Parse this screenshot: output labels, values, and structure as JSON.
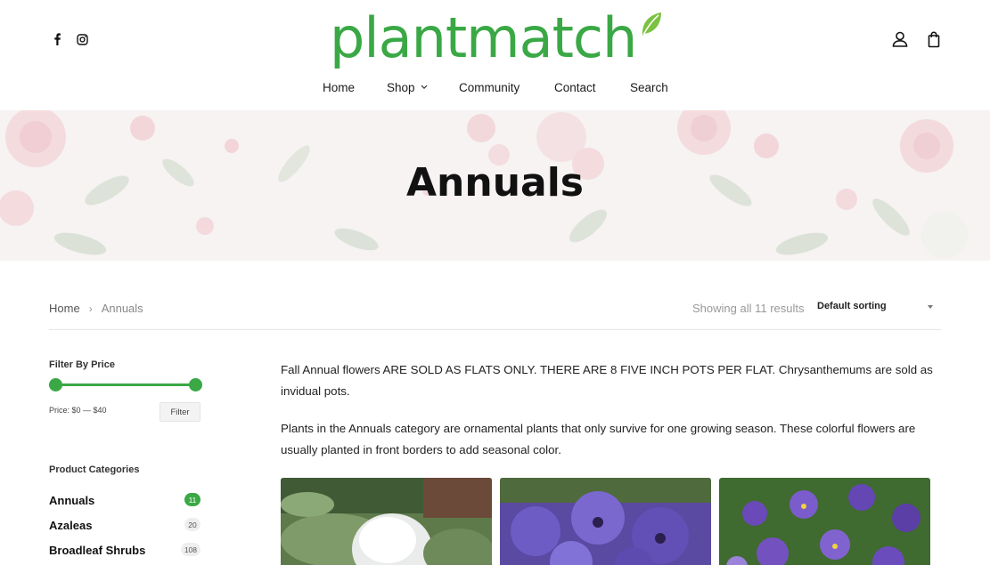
{
  "brand": {
    "name": "plantmatch",
    "color": "#3aa845"
  },
  "header": {
    "social": [
      {
        "icon": "facebook-icon",
        "glyph": "f"
      },
      {
        "icon": "instagram-icon"
      }
    ],
    "account_icon": "user-icon",
    "cart_icon": "shopping-bag-icon"
  },
  "nav": {
    "items": [
      {
        "label": "Home"
      },
      {
        "label": "Shop"
      },
      {
        "label": "Community"
      },
      {
        "label": "Contact"
      },
      {
        "label": "Search"
      }
    ]
  },
  "hero": {
    "title": "Annuals"
  },
  "breadcrumb": {
    "home": "Home",
    "separator": "›",
    "current": "Annuals"
  },
  "results": {
    "text": "Showing all 11 results"
  },
  "sort": {
    "selected": "Default sorting"
  },
  "sidebar": {
    "price_filter": {
      "title": "Filter By Price",
      "label": "Price: $0 — $40",
      "button": "Filter",
      "min": 0,
      "max": 40
    },
    "categories": {
      "title": "Product Categories",
      "items": [
        {
          "name": "Annuals",
          "count": "11",
          "active": true
        },
        {
          "name": "Azaleas",
          "count": "20",
          "active": false
        },
        {
          "name": "Broadleaf Shrubs",
          "count": "108",
          "active": false
        }
      ]
    }
  },
  "content": {
    "paragraphs": [
      "Fall Annual flowers ARE SOLD AS FLATS ONLY. THERE ARE 8 FIVE INCH POTS PER FLAT. Chrysanthemums are sold as invidual pots.",
      "Plants in the Annuals category are ornamental plants that only survive for one growing season. These colorful flowers are usually planted in front borders to add seasonal color."
    ]
  }
}
